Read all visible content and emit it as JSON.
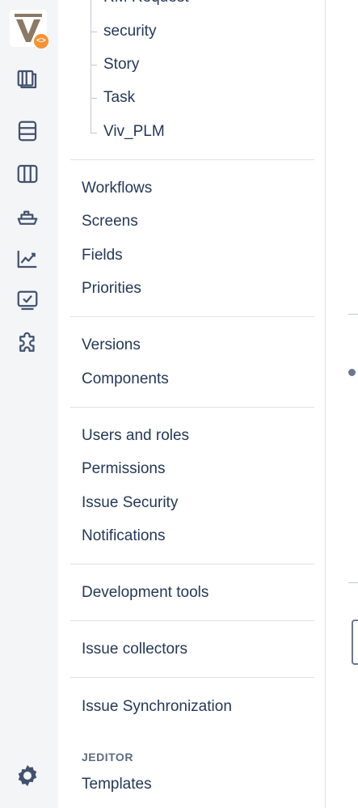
{
  "rail": {
    "icons": [
      "board-icon",
      "backlog-icon",
      "columns-icon",
      "releases-icon",
      "reports-icon",
      "issues-icon",
      "addons-icon"
    ],
    "settings_icon": "gear-icon",
    "logo_badge": "<>"
  },
  "issue_types": [
    "RM Request",
    "security",
    "Story",
    "Task",
    "Viv_PLM"
  ],
  "groups": {
    "workflow_items": [
      "Workflows",
      "Screens",
      "Fields",
      "Priorities"
    ],
    "version_items": [
      "Versions",
      "Components"
    ],
    "people_items": [
      "Users and roles",
      "Permissions",
      "Issue Security",
      "Notifications"
    ],
    "dev_tools": "Development tools",
    "collectors": "Issue collectors",
    "sync": "Issue Synchronization"
  },
  "jeditor": {
    "heading": "JEDITOR",
    "templates": "Templates"
  }
}
